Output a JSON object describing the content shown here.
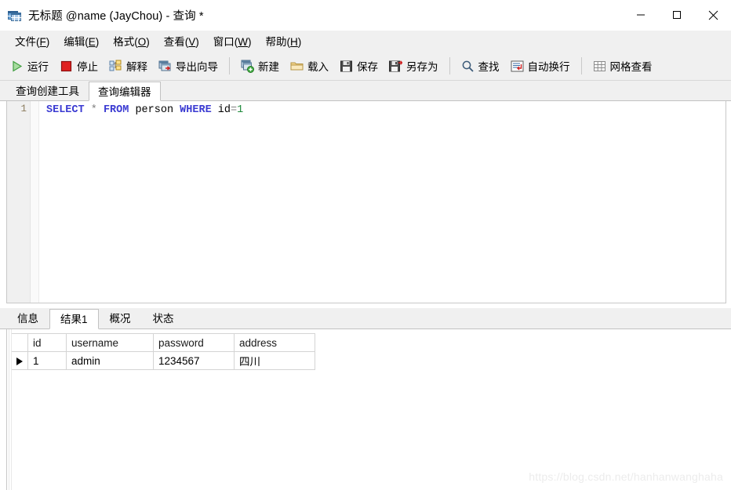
{
  "window": {
    "title": "无标题 @name (JayChou) - 查询 *",
    "icon": "table-window-icon",
    "controls": {
      "minimize": "minimize-icon",
      "maximize": "maximize-icon",
      "close": "close-icon"
    }
  },
  "menubar": {
    "items": [
      {
        "label": "文件",
        "accel": "F"
      },
      {
        "label": "编辑",
        "accel": "E"
      },
      {
        "label": "格式",
        "accel": "O"
      },
      {
        "label": "查看",
        "accel": "V"
      },
      {
        "label": "窗口",
        "accel": "W"
      },
      {
        "label": "帮助",
        "accel": "H"
      }
    ]
  },
  "toolbar": {
    "groups": [
      [
        {
          "label": "运行",
          "icon": "play-icon"
        },
        {
          "label": "停止",
          "icon": "stop-icon"
        },
        {
          "label": "解释",
          "icon": "explain-tree-icon"
        },
        {
          "label": "导出向导",
          "icon": "export-wizard-icon"
        }
      ],
      [
        {
          "label": "新建",
          "icon": "new-query-icon"
        },
        {
          "label": "载入",
          "icon": "open-folder-icon"
        },
        {
          "label": "保存",
          "icon": "save-icon"
        },
        {
          "label": "另存为",
          "icon": "save-as-icon"
        }
      ],
      [
        {
          "label": "查找",
          "icon": "search-icon"
        },
        {
          "label": "自动换行",
          "icon": "word-wrap-icon"
        }
      ],
      [
        {
          "label": "网格查看",
          "icon": "grid-view-icon"
        }
      ]
    ]
  },
  "editor_tabs": {
    "items": [
      {
        "label": "查询创建工具",
        "active": false
      },
      {
        "label": "查询编辑器",
        "active": true
      }
    ]
  },
  "editor": {
    "line_number": "1",
    "sql": {
      "select": "SELECT",
      "star": "*",
      "from": "FROM",
      "table": "person",
      "where": "WHERE",
      "column": "id",
      "equals": "=",
      "value": "1"
    },
    "full_text": "SELECT * FROM person WHERE id=1"
  },
  "result_tabs": {
    "items": [
      {
        "label": "信息",
        "active": false
      },
      {
        "label": "结果1",
        "active": true
      },
      {
        "label": "概况",
        "active": false
      },
      {
        "label": "状态",
        "active": false
      }
    ]
  },
  "result_grid": {
    "columns": [
      "id",
      "username",
      "password",
      "address"
    ],
    "selected_column": "id",
    "rows": [
      {
        "current": true,
        "id": "1",
        "username": "admin",
        "password": "1234567",
        "address": "四川"
      }
    ]
  },
  "watermark": {
    "text": "https://blog.csdn.net/hanhanwanghaha"
  },
  "colors": {
    "keyword": "#3b3bd2",
    "number": "#1f8a3c",
    "operator": "#808080",
    "selection": "#d7e7f7",
    "chrome": "#f0f0f0"
  }
}
